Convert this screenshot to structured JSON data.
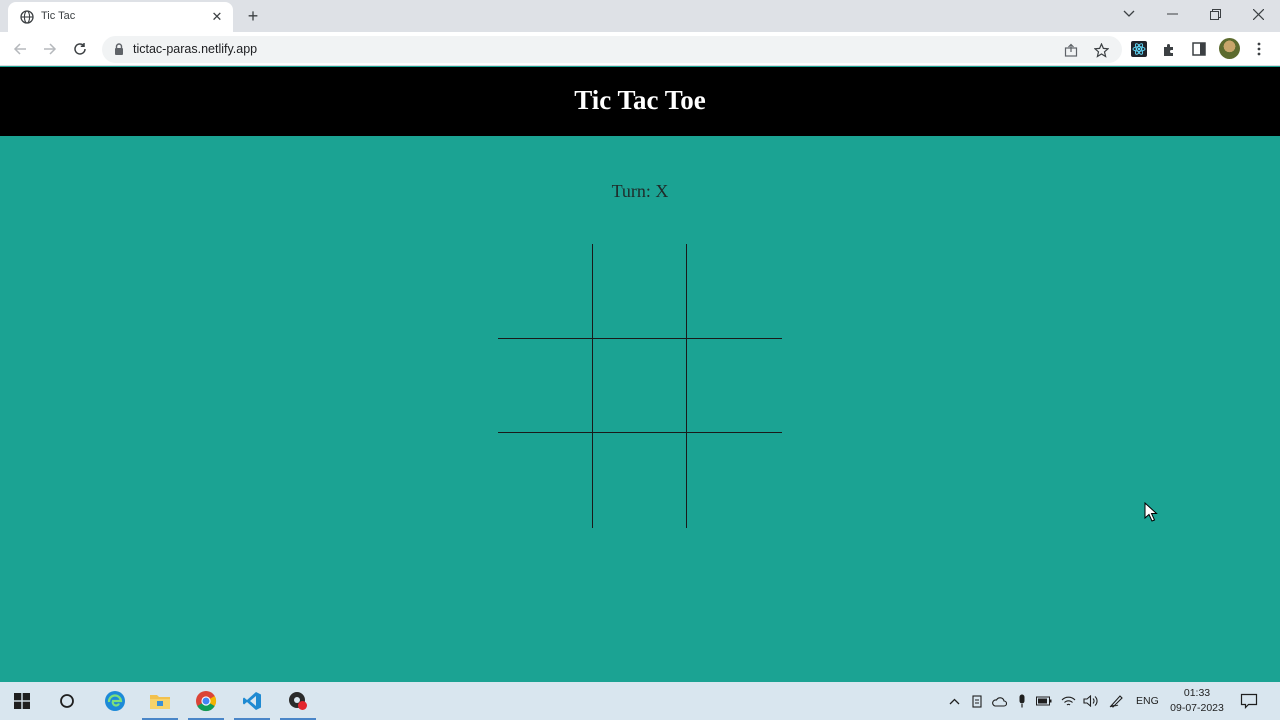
{
  "browser": {
    "tab": {
      "title": "Tic Tac",
      "favicon": "globe-icon"
    },
    "url": "tictac-paras.netlify.app"
  },
  "app": {
    "title": "Tic Tac Toe",
    "turn_text": "Turn: X",
    "board": [
      "",
      "",
      "",
      "",
      "",
      "",
      "",
      "",
      ""
    ],
    "colors": {
      "background": "#1ba393",
      "header": "#000000",
      "grid_lines": "#1a1a1a"
    }
  },
  "taskbar": {
    "language": "ENG",
    "time": "01:33",
    "date": "09-07-2023",
    "pinned": [
      "start-icon",
      "search-icon",
      "edge-icon",
      "file-explorer-icon",
      "chrome-icon",
      "vscode-icon",
      "recorder-icon"
    ]
  }
}
